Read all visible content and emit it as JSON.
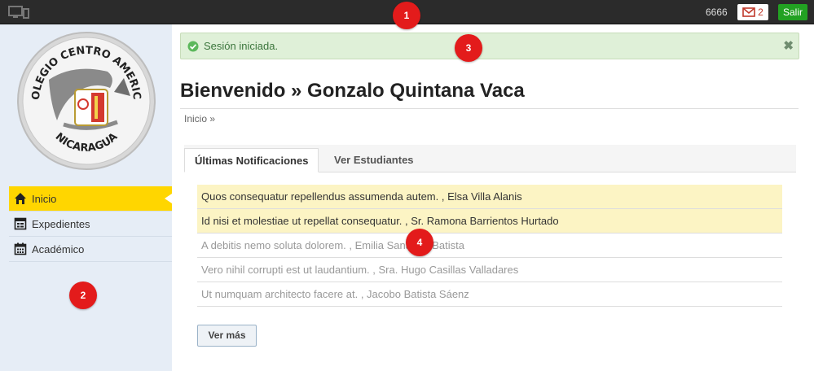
{
  "topbar": {
    "user_id": "6666",
    "mail_count": "2",
    "logout_label": "Salir"
  },
  "markers": [
    "1",
    "2",
    "3",
    "4"
  ],
  "sidebar": {
    "logo_text": "COLEGIO CENTRO AMERICA NICARAGUA",
    "items": [
      {
        "label": "Inicio",
        "icon": "home-icon",
        "active": true
      },
      {
        "label": "Expedientes",
        "icon": "record-icon",
        "active": false
      },
      {
        "label": "Académico",
        "icon": "calendar-icon",
        "active": false
      }
    ]
  },
  "alert": {
    "text": "Sesión iniciada.",
    "status_color": "#dff0d8"
  },
  "main": {
    "title": "Bienvenido » Gonzalo Quintana Vaca",
    "breadcrumb": "Inicio »",
    "tabs": [
      {
        "label": "Últimas Notificaciones",
        "active": true
      },
      {
        "label": "Ver Estudiantes",
        "active": false
      }
    ],
    "notifications": [
      {
        "text": "Quos consequatur repellendus assumenda autem. , Elsa Villa Alanis",
        "unread": true
      },
      {
        "text": "Id nisi et molestiae ut repellat consequatur. , Sr. Ramona Barrientos Hurtado",
        "unread": true
      },
      {
        "text": "A debitis nemo soluta dolorem. , Emilia Sanabria Batista",
        "unread": false
      },
      {
        "text": "Vero nihil corrupti est ut laudantium. , Sra. Hugo Casillas Valladares",
        "unread": false
      },
      {
        "text": "Ut numquam architecto facere at. , Jacobo Batista Sáenz",
        "unread": false
      }
    ],
    "more_label": "Ver más"
  },
  "colors": {
    "topbar": "#2b2b2b",
    "sidebar": "#e6edf6",
    "active_nav": "#ffd600",
    "unread_row": "#fcf4c4",
    "logout": "#22a122",
    "marker": "#e31b1b"
  }
}
